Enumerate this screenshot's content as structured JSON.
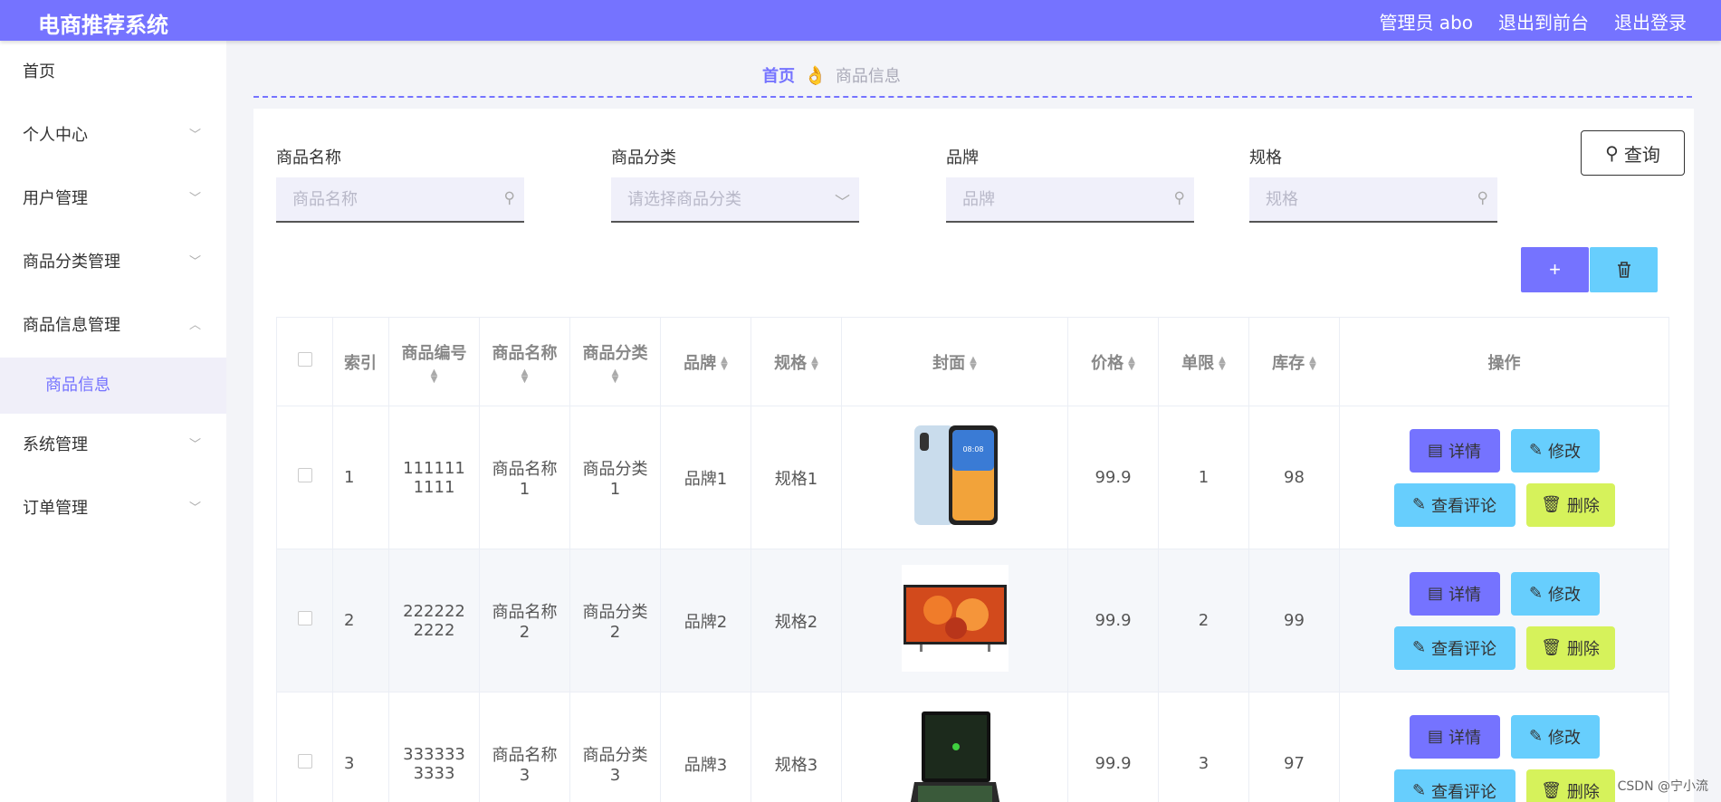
{
  "header": {
    "brand": "电商推荐系统",
    "admin": "管理员 abo",
    "to_front": "退出到前台",
    "logout": "退出登录",
    "color": "#7573ff"
  },
  "sidebar": {
    "items": [
      {
        "label": "首页"
      },
      {
        "label": "个人中心"
      },
      {
        "label": "用户管理"
      },
      {
        "label": "商品分类管理"
      },
      {
        "label": "商品信息管理"
      },
      {
        "label": "商品信息"
      },
      {
        "label": "系统管理"
      },
      {
        "label": "订单管理"
      }
    ]
  },
  "breadcrumb": {
    "home": "首页",
    "current": "商品信息"
  },
  "search": {
    "name_label": "商品名称",
    "name_placeholder": "商品名称",
    "category_label": "商品分类",
    "category_placeholder": "请选择商品分类",
    "brand_label": "品牌",
    "brand_placeholder": "品牌",
    "spec_label": "规格",
    "spec_placeholder": "规格",
    "query_label": "查询"
  },
  "table": {
    "headers": {
      "index": "索引",
      "code": "商品编号",
      "name": "商品名称",
      "category": "商品分类",
      "brand": "品牌",
      "spec": "规格",
      "cover": "封面",
      "price": "价格",
      "limit": "单限",
      "stock": "库存",
      "ops": "操作"
    },
    "rows": [
      {
        "index": "1",
        "code": "1111111111",
        "name": "商品名称1",
        "category": "商品分类1",
        "brand": "品牌1",
        "spec": "规格1",
        "price": "99.9",
        "limit": "1",
        "stock": "98",
        "cover": "phone"
      },
      {
        "index": "2",
        "code": "2222222222",
        "name": "商品名称2",
        "category": "商品分类2",
        "brand": "品牌2",
        "spec": "规格2",
        "price": "99.9",
        "limit": "2",
        "stock": "99",
        "cover": "tv"
      },
      {
        "index": "3",
        "code": "3333333333",
        "name": "商品名称3",
        "category": "商品分类3",
        "brand": "品牌3",
        "spec": "规格3",
        "price": "99.9",
        "limit": "3",
        "stock": "97",
        "cover": "laptop"
      }
    ],
    "op_labels": {
      "detail": "详情",
      "edit": "修改",
      "review": "查看评论",
      "delete": "删除"
    }
  },
  "watermark": "CSDN @宁小流"
}
